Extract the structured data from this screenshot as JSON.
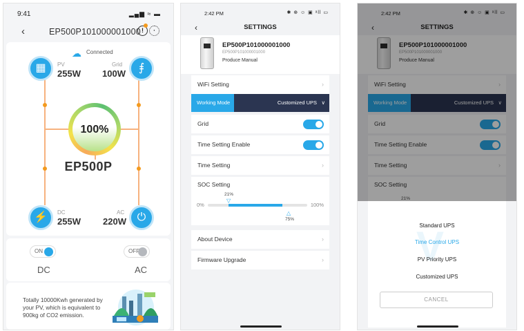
{
  "screen1": {
    "status_time": "9:41",
    "status_icons": "▂▄▆ ≈ ▬",
    "title": "EP500P101000001000",
    "connection": "Connected",
    "pv": {
      "label": "PV",
      "value": "255W"
    },
    "grid": {
      "label": "Grid",
      "value": "100W"
    },
    "battery_percent": "100%",
    "device_name": "EP500P",
    "dc_out": {
      "label": "DC",
      "value": "255W"
    },
    "ac_out": {
      "label": "AC",
      "value": "220W"
    },
    "dc_toggle": {
      "state": "ON",
      "label": "DC"
    },
    "ac_toggle": {
      "state": "OFF",
      "label": "AC"
    },
    "info_text": "Totally 10000Kwh generated by your PV, which is equivalent to 900kg of CO2 emission.",
    "colors": {
      "accent": "#29a8e8",
      "orange": "#f39a1e",
      "line": "#f7b27e"
    }
  },
  "settings": {
    "status_time": "2:42 PM",
    "status_icons": "✱ ⊕ ☺ ▣ ᵃll ▭",
    "title": "SETTINGS",
    "device_name": "EP500P101000001000",
    "device_serial": "EP500P101000001000",
    "manual_link": "Produce Manual",
    "wifi_setting": "WiFi Setting",
    "working_mode_label": "Working Mode",
    "working_mode_value": "Customized UPS",
    "grid": "Grid",
    "time_setting_enable": "Time Setting Enable",
    "time_setting": "Time Setting",
    "soc_setting": "SOC Setting",
    "soc_low": "21%",
    "soc_high": "75%",
    "soc_min_label": "0%",
    "soc_max_label": "100%",
    "about_device": "About Device",
    "firmware_upgrade": "Firmware Upgrade"
  },
  "mode_sheet": {
    "options": [
      "Standard UPS",
      "Time Control UPS",
      "PV Priority UPS",
      "Customized UPS"
    ],
    "selected": "Time Control UPS",
    "cancel": "CANCEL"
  }
}
